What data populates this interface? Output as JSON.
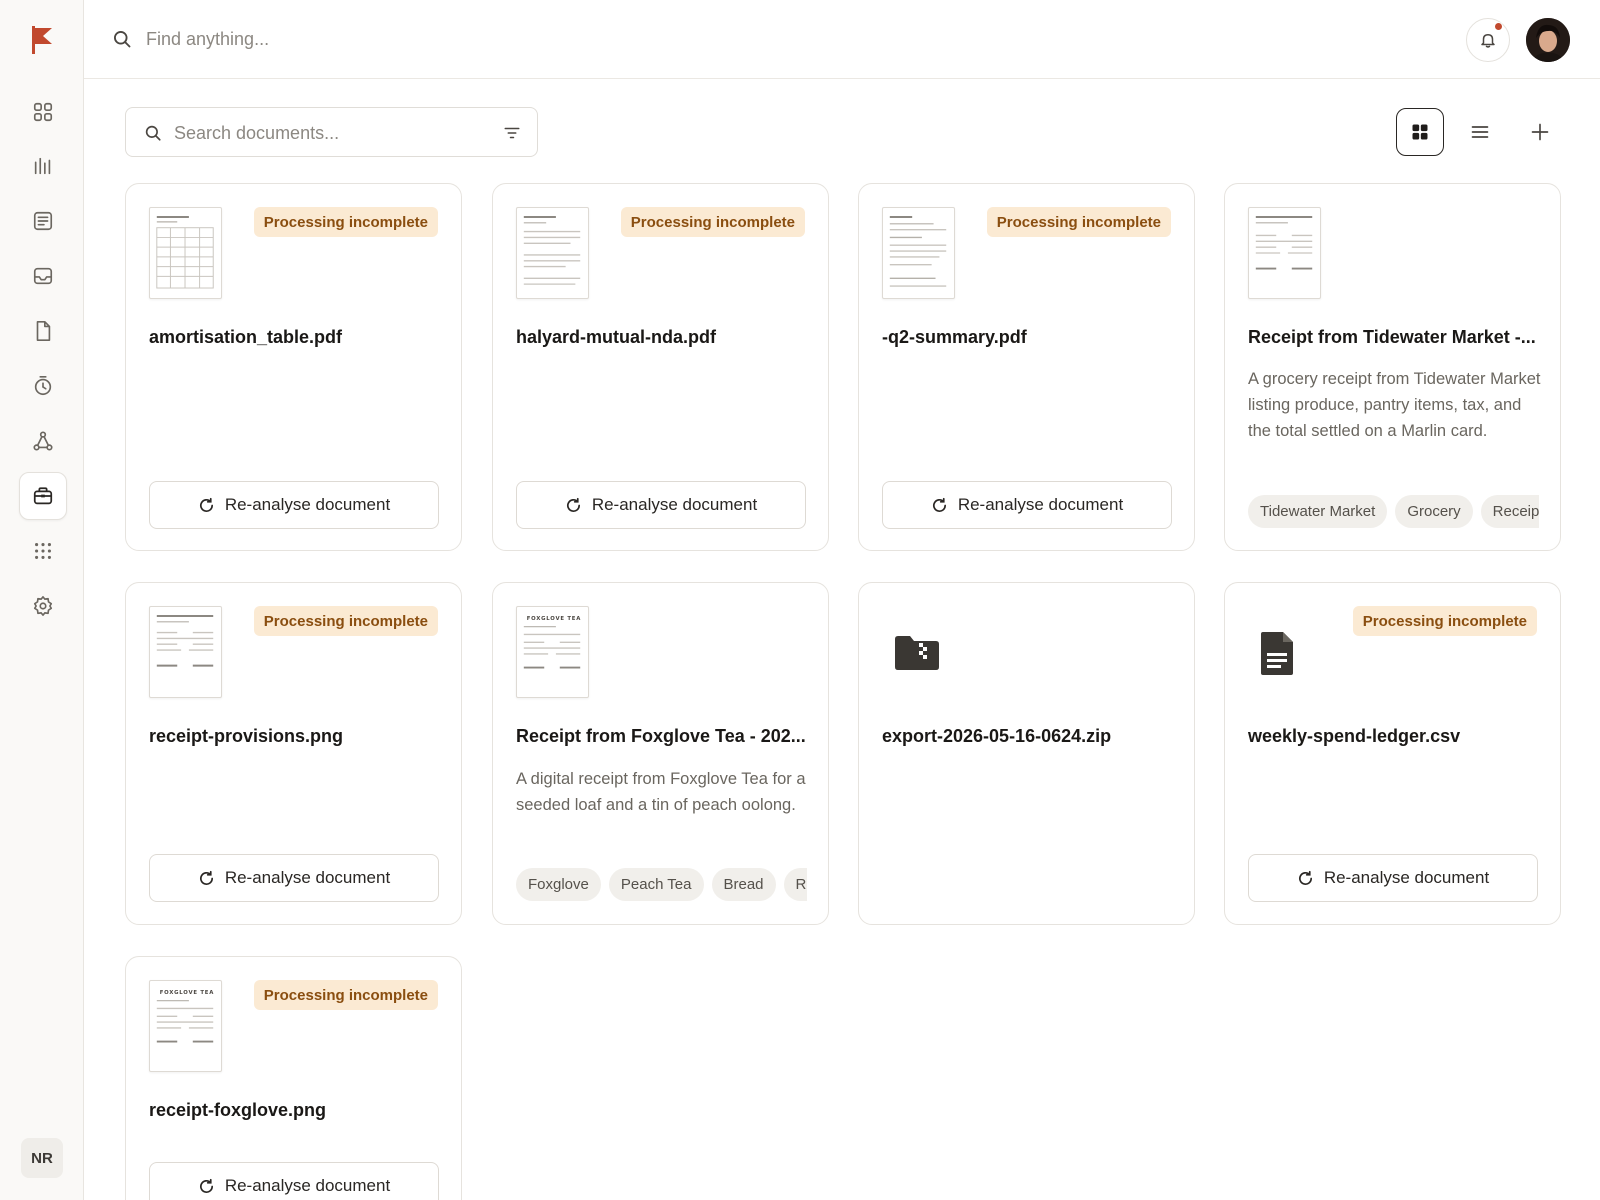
{
  "app": {
    "brand_color": "#c1492e",
    "user_initials": "NR"
  },
  "topbar": {
    "search_placeholder": "Find anything..."
  },
  "toolbar": {
    "search_placeholder": "Search documents..."
  },
  "sidebar": {
    "items": [
      {
        "icon": "dashboard-icon",
        "active": false
      },
      {
        "icon": "analytics-icon",
        "active": false
      },
      {
        "icon": "notes-icon",
        "active": false
      },
      {
        "icon": "inbox-icon",
        "active": false
      },
      {
        "icon": "file-icon",
        "active": false
      },
      {
        "icon": "timer-icon",
        "active": false
      },
      {
        "icon": "network-icon",
        "active": false
      },
      {
        "icon": "briefcase-icon",
        "active": true
      },
      {
        "icon": "apps-grid-icon",
        "active": false
      },
      {
        "icon": "settings-icon",
        "active": false
      }
    ]
  },
  "labels": {
    "processing_incomplete": "Processing incomplete",
    "reanalyse": "Re-analyse document"
  },
  "documents": [
    {
      "title": "amortisation_table.pdf",
      "status": "Processing incomplete"
    },
    {
      "title": "halyard-mutual-nda.pdf",
      "status": "Processing incomplete"
    },
    {
      "title": "-q2-summary.pdf",
      "status": "Processing incomplete"
    },
    {
      "title": "Receipt from Tidewater Market -...",
      "description": "A grocery receipt from Tidewater Market listing produce, pantry items, tax, and the total settled on a Marlin card.",
      "tags": [
        "Tidewater Market",
        "Grocery",
        "Receipt"
      ]
    },
    {
      "title": "receipt-provisions.png",
      "status": "Processing incomplete"
    },
    {
      "title": "Receipt from Foxglove Tea - 202...",
      "thumb_header": "FOXGLOVE TEA",
      "description": "A digital receipt from Foxglove Tea for a seeded loaf and a tin of peach oolong.",
      "tags": [
        "Foxglove",
        "Peach Tea",
        "Bread",
        "Receipt"
      ]
    },
    {
      "title": "export-2026-05-16-0624.zip"
    },
    {
      "title": "weekly-spend-ledger.csv",
      "status": "Processing incomplete"
    },
    {
      "title": "receipt-foxglove.png",
      "thumb_header": "FOXGLOVE TEA",
      "status": "Processing incomplete"
    }
  ]
}
